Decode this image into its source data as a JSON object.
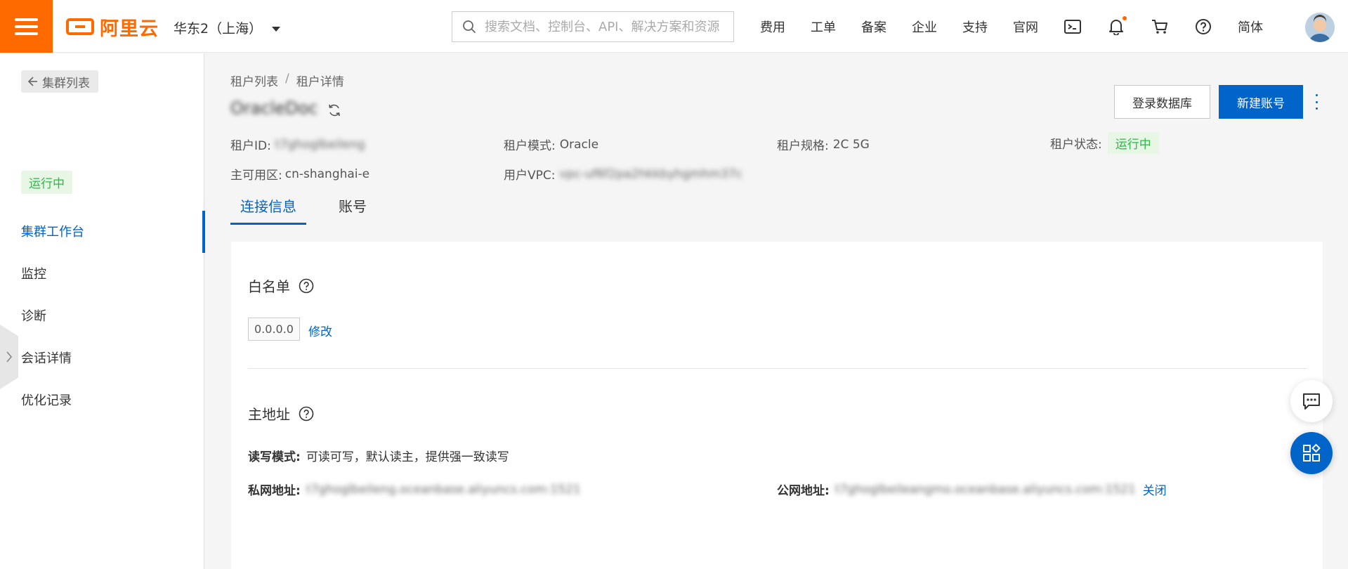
{
  "topbar": {
    "logo_text": "阿里云",
    "region": "华东2（上海）",
    "search_placeholder": "搜索文档、控制台、API、解决方案和资源",
    "nav": [
      "费用",
      "工单",
      "备案",
      "企业",
      "支持",
      "官网"
    ],
    "lang": "简体",
    "accent_color": "#ff6a00"
  },
  "sidebar": {
    "back_label": "集群列表",
    "status": "运行中",
    "items": [
      "集群工作台",
      "监控",
      "诊断",
      "会话详情",
      "优化记录"
    ],
    "active_index": 0
  },
  "header": {
    "breadcrumb": [
      "租户列表",
      "租户详情"
    ],
    "breadcrumb_sep": "/",
    "tenant_name": "OracleDoc",
    "login_button": "登录数据库",
    "new_account_button": "新建账号"
  },
  "info": {
    "tenant_id_label": "租户ID:",
    "tenant_id": "t7ghoglbeileng",
    "mode_label": "租户模式:",
    "mode": "Oracle",
    "spec_label": "租户规格:",
    "spec": "2C 5G",
    "state_label": "租户状态:",
    "state": "运行中",
    "zone_label": "主可用区:",
    "zone": "cn-shanghai-e",
    "vpc_label": "用户VPC:",
    "vpc": "vpc-uf6f2pa2hkkbyhgmhm37c"
  },
  "tabs": [
    "连接信息",
    "账号"
  ],
  "whitelist": {
    "title": "白名单",
    "ip": "0.0.0.0",
    "edit": "修改"
  },
  "address": {
    "title": "主地址",
    "rw_label": "读写模式:",
    "rw_value": "可读可写，默认读主，提供强一致读写",
    "private_label": "私网地址:",
    "private_value": "t7ghoglbeileng.oceanbase.aliyuncs.com:1521",
    "public_label": "公网地址:",
    "public_value": "t7ghoglbeileangmo.oceanbase.aliyuncs.com:1521",
    "close": "关闭"
  },
  "colors": {
    "primary": "#0064c8",
    "success": "#2eb84b"
  }
}
